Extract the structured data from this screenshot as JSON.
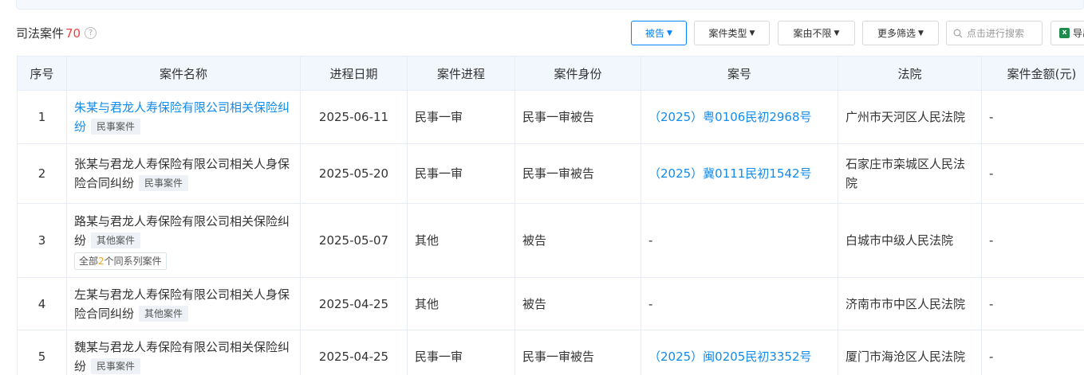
{
  "header": {
    "title": "司法案件",
    "count": "70",
    "help_glyph": "?"
  },
  "filters": {
    "defendant": "被告",
    "case_type": "案件类型",
    "cause": "案由不限",
    "more": "更多筛选",
    "search_placeholder": "点击进行搜索",
    "export": "导出"
  },
  "table": {
    "columns": [
      "序号",
      "案件名称",
      "进程日期",
      "案件进程",
      "案件身份",
      "案号",
      "法院",
      "案件金额(元)"
    ],
    "rows": [
      {
        "no": "1",
        "name": "朱某与君龙人寿保险有限公司相关保险纠纷",
        "tag": "民事案件",
        "date": "2025-06-11",
        "stage": "民事一审",
        "role": "民事一审被告",
        "case_no": "（2025）粤0106民初2968号",
        "court": "广州市天河区人民法院",
        "amount": "-"
      },
      {
        "no": "2",
        "name": "张某与君龙人寿保险有限公司相关人身保险合同纠纷",
        "tag": "民事案件",
        "date": "2025-05-20",
        "stage": "民事一审",
        "role": "民事一审被告",
        "case_no": "（2025）冀0111民初1542号",
        "court": "石家庄市栾城区人民法院",
        "amount": "-"
      },
      {
        "no": "3",
        "name": "路某与君龙人寿保险有限公司相关保险纠纷",
        "tag": "其他案件",
        "series_prefix": "全部",
        "series_count": "2",
        "series_suffix": "个同系列案件",
        "date": "2025-05-07",
        "stage": "其他",
        "role": "被告",
        "case_no": "-",
        "court": "白城市中级人民法院",
        "amount": "-"
      },
      {
        "no": "4",
        "name": "左某与君龙人寿保险有限公司相关人身保险合同纠纷",
        "tag": "其他案件",
        "date": "2025-04-25",
        "stage": "其他",
        "role": "被告",
        "case_no": "-",
        "court": "济南市市中区人民法院",
        "amount": "-"
      },
      {
        "no": "5",
        "name": "魏某与君龙人寿保险有限公司相关保险纠纷",
        "tag": "民事案件",
        "date": "2025-04-25",
        "stage": "民事一审",
        "role": "民事一审被告",
        "case_no": "（2025）闽0205民初3352号",
        "court": "厦门市海沧区人民法院",
        "amount": "-"
      }
    ]
  },
  "colors": {
    "accent": "#128bed",
    "count_red": "#f04142",
    "series_orange": "#f5a623",
    "header_bg": "#f2f7fd"
  }
}
